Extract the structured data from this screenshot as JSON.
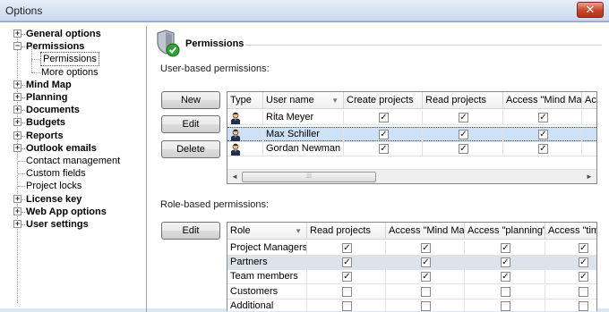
{
  "window": {
    "title": "Options",
    "close_glyph": "✕"
  },
  "tree": {
    "items": [
      {
        "label": "General options",
        "bold": true,
        "expander": "+"
      },
      {
        "label": "Permissions",
        "bold": true,
        "expander": "−"
      },
      {
        "label": "Permissions",
        "bold": false,
        "child": true,
        "selected": true
      },
      {
        "label": "More options",
        "bold": false,
        "child": true
      },
      {
        "label": "Mind Map",
        "bold": true,
        "expander": "+"
      },
      {
        "label": "Planning",
        "bold": true,
        "expander": "+"
      },
      {
        "label": "Documents",
        "bold": true,
        "expander": "+"
      },
      {
        "label": "Budgets",
        "bold": true,
        "expander": "+"
      },
      {
        "label": "Reports",
        "bold": true,
        "expander": "+"
      },
      {
        "label": "Outlook emails",
        "bold": true,
        "expander": "+"
      },
      {
        "label": "Contact management",
        "bold": false
      },
      {
        "label": "Custom fields",
        "bold": false
      },
      {
        "label": "Project locks",
        "bold": false
      },
      {
        "label": "License key",
        "bold": true,
        "expander": "+"
      },
      {
        "label": "Web App options",
        "bold": true,
        "expander": "+"
      },
      {
        "label": "User settings",
        "bold": true,
        "expander": "+"
      }
    ]
  },
  "panel": {
    "heading": "Permissions",
    "icon": "shield-check-icon",
    "user_section_label": "User-based permissions:",
    "role_section_label": "Role-based permissions:",
    "buttons": {
      "new": "New",
      "edit": "Edit",
      "delete": "Delete",
      "role_edit": "Edit"
    }
  },
  "user_grid": {
    "columns": [
      "Type",
      "User name",
      "Create projects",
      "Read projects",
      "Access \"Mind Ma...",
      "Ac"
    ],
    "rows": [
      {
        "name": "Rita Meyer",
        "checks": [
          true,
          true,
          true
        ],
        "selected": false
      },
      {
        "name": "Max Schiller",
        "checks": [
          true,
          true,
          true
        ],
        "selected": true
      },
      {
        "name": "Gordan Newman",
        "checks": [
          true,
          true,
          true
        ],
        "selected": false
      }
    ],
    "scroll": {
      "left": "◄",
      "right": "►",
      "thumb": "⁞⁞⁞"
    }
  },
  "role_grid": {
    "columns": [
      "Role",
      "Read projects",
      "Access \"Mind Ma...",
      "Access \"planning\"",
      "Access \"time"
    ],
    "rows": [
      {
        "name": "Project Managers",
        "checks": [
          true,
          true,
          true,
          true
        ]
      },
      {
        "name": "Partners",
        "checks": [
          true,
          true,
          true,
          true
        ],
        "alt": true
      },
      {
        "name": "Team members",
        "checks": [
          true,
          true,
          true,
          true
        ]
      },
      {
        "name": "Customers",
        "checks": [
          false,
          false,
          false,
          false
        ]
      },
      {
        "name": "Additional",
        "checks": [
          false,
          false,
          false,
          false
        ]
      }
    ]
  },
  "glyphs": {
    "check": "✓",
    "sort": "▼"
  },
  "colors": {
    "selection": "#cde2f7",
    "alt_row": "#dde3ea",
    "close": "#c8442a"
  }
}
